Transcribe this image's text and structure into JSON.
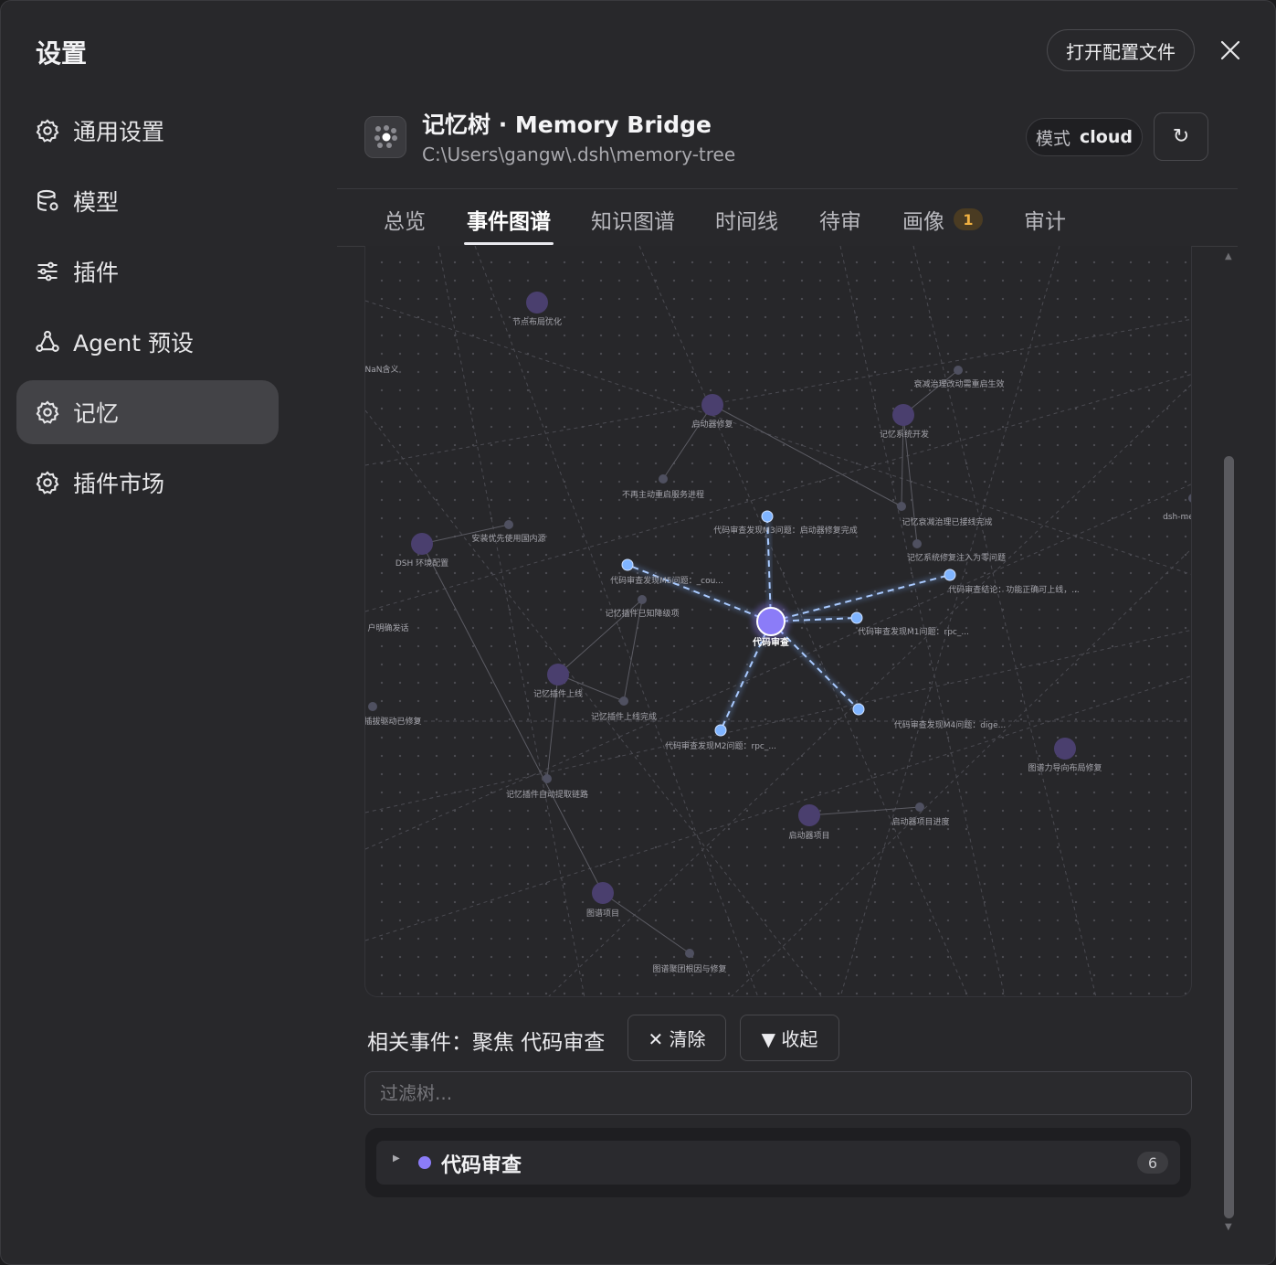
{
  "settings": {
    "title": "设置"
  },
  "nav": {
    "items": [
      {
        "label": "通用设置",
        "icon": "gear-icon"
      },
      {
        "label": "模型",
        "icon": "database-icon"
      },
      {
        "label": "插件",
        "icon": "sliders-icon"
      },
      {
        "label": "Agent 预设",
        "icon": "agent-icon"
      },
      {
        "label": "记忆",
        "icon": "gear-icon",
        "active": true
      },
      {
        "label": "插件市场",
        "icon": "gear-icon"
      }
    ]
  },
  "top": {
    "open_config": "打开配置文件",
    "close_icon": "close-icon"
  },
  "memory": {
    "title": "记忆树 · Memory Bridge",
    "path": "C:\\Users\\gangw\\.dsh\\memory-tree",
    "mode_label": "模式",
    "mode_value": "cloud",
    "refresh_icon": "↻"
  },
  "tabs": [
    {
      "label": "总览"
    },
    {
      "label": "事件图谱",
      "active": true
    },
    {
      "label": "知识图谱"
    },
    {
      "label": "时间线"
    },
    {
      "label": "待审"
    },
    {
      "label": "画像",
      "badge": "1"
    },
    {
      "label": "审计"
    }
  ],
  "graph": {
    "focus_node": "代码审查",
    "nodes": [
      {
        "label": "节点布局优化"
      },
      {
        "label": "NaN含义"
      },
      {
        "label": "衰减治理改动需重启生效"
      },
      {
        "label": "启动器修复"
      },
      {
        "label": "记忆系统开发"
      },
      {
        "label": "不再主动重启服务进程"
      },
      {
        "label": "代码审查发现M3问题：启动器修复完成"
      },
      {
        "label": "记忆衰减治理已接线完成"
      },
      {
        "label": "记忆系统修复注入为零问题"
      },
      {
        "label": "安装优先使用国内源"
      },
      {
        "label": "DSH 环境配置"
      },
      {
        "label": "dsh-me"
      },
      {
        "label": "代码审查发现M5问题：_cou..."
      },
      {
        "label": "代码审查结论：功能正确可上线，..."
      },
      {
        "label": "记忆插件已知降级项"
      },
      {
        "label": "户明确发话"
      },
      {
        "label": "代码审查"
      },
      {
        "label": "代码审查发现M1问题：rpc_..."
      },
      {
        "label": "记忆插件上线"
      },
      {
        "label": "记忆插件上线完成"
      },
      {
        "label": "插拔驱动已修复"
      },
      {
        "label": "代码审查发现M4问题：dige..."
      },
      {
        "label": "代码审查发现M2问题：rpc_..."
      },
      {
        "label": "图谱力导向布局修复"
      },
      {
        "label": "记忆插件自动提取链路"
      },
      {
        "label": "启动器项目进度"
      },
      {
        "label": "启动器项目"
      },
      {
        "label": "图谱项目"
      },
      {
        "label": "图谱聚团根因与修复"
      }
    ]
  },
  "related": {
    "title": "相关事件：聚焦 代码审查",
    "clear": "✕ 清除",
    "collapse": "▼ 收起"
  },
  "filter": {
    "placeholder": "过滤树..."
  },
  "tree": {
    "label": "代码审查",
    "count": "6",
    "dot_color": "#8b7cf8"
  }
}
